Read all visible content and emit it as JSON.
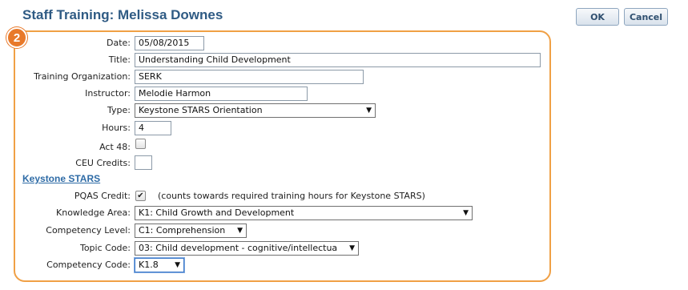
{
  "page": {
    "title": "Staff Training: Melissa Downes"
  },
  "toolbar": {
    "ok_label": "OK",
    "cancel_label": "Cancel"
  },
  "step_badge": "2",
  "form": {
    "date": {
      "label": "Date:",
      "value": "05/08/2015"
    },
    "title": {
      "label": "Title:",
      "value": "Understanding Child Development"
    },
    "organization": {
      "label": "Training Organization:",
      "value": "SERK"
    },
    "instructor": {
      "label": "Instructor:",
      "value": "Melodie Harmon"
    },
    "type": {
      "label": "Type:",
      "selected": "Keystone STARS Orientation"
    },
    "hours": {
      "label": "Hours:",
      "value": "4"
    },
    "act48": {
      "label": "Act 48:",
      "checked": false
    },
    "ceu": {
      "label": "CEU Credits:",
      "value": ""
    }
  },
  "keystone": {
    "heading": "Keystone STARS",
    "pqas": {
      "label": "PQAS Credit:",
      "checked": true,
      "note": "(counts towards required training hours for Keystone STARS)"
    },
    "knowledge_area": {
      "label": "Knowledge Area:",
      "selected": "K1: Child Growth and Development"
    },
    "competency_level": {
      "label": "Competency Level:",
      "selected": "C1: Comprehension"
    },
    "topic_code": {
      "label": "Topic Code:",
      "selected": "03: Child development - cognitive/intellectua"
    },
    "competency_code": {
      "label": "Competency Code:",
      "selected": "K1.8"
    }
  },
  "colors": {
    "accent_orange": "#f0a045",
    "title_blue": "#2f5b84",
    "link_blue": "#2e6ba6"
  },
  "icons": {
    "dropdown": "chevron-down-icon",
    "check": "checkmark-icon"
  }
}
